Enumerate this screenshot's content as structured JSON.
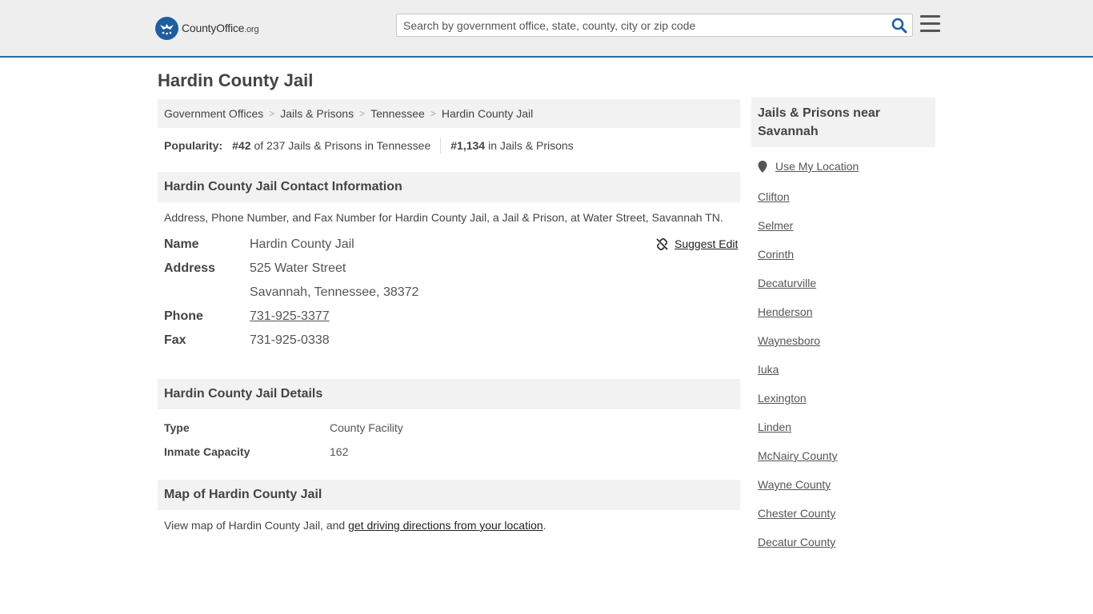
{
  "header": {
    "logo_main": "CountyOffice",
    "logo_tld": ".org",
    "search_placeholder": "Search by government office, state, county, city or zip code"
  },
  "page": {
    "title": "Hardin County Jail"
  },
  "breadcrumb": [
    "Government Offices",
    "Jails & Prisons",
    "Tennessee",
    "Hardin County Jail"
  ],
  "popularity": {
    "label": "Popularity:",
    "state_rank": "#42",
    "state_text": "of 237 Jails & Prisons in Tennessee",
    "national_rank": "#1,134",
    "national_text": "in Jails & Prisons"
  },
  "contact": {
    "heading": "Hardin County Jail Contact Information",
    "description": "Address, Phone Number, and Fax Number for Hardin County Jail, a Jail & Prison, at Water Street, Savannah TN.",
    "suggest_edit": "Suggest Edit",
    "name_label": "Name",
    "name": "Hardin County Jail",
    "address_label": "Address",
    "address_line1": "525 Water Street",
    "address_line2": "Savannah, Tennessee, 38372",
    "phone_label": "Phone",
    "phone": "731-925-3377",
    "fax_label": "Fax",
    "fax": "731-925-0338"
  },
  "details": {
    "heading": "Hardin County Jail Details",
    "type_label": "Type",
    "type": "County Facility",
    "capacity_label": "Inmate Capacity",
    "capacity": "162"
  },
  "map": {
    "heading": "Map of Hardin County Jail",
    "desc_prefix": "View map of Hardin County Jail, and ",
    "desc_link": "get driving directions from your location",
    "desc_suffix": "."
  },
  "sidebar": {
    "heading": "Jails & Prisons near Savannah",
    "use_location": "Use My Location",
    "items": [
      "Clifton",
      "Selmer",
      "Corinth",
      "Decaturville",
      "Henderson",
      "Waynesboro",
      "Iuka",
      "Lexington",
      "Linden",
      "McNairy County",
      "Wayne County",
      "Chester County",
      "Decatur County"
    ]
  },
  "colors": {
    "header_bg": "#eeeeee",
    "accent": "#2d6aa8",
    "logo_blue": "#1f5e9e",
    "panel_bg": "#f2f2f2"
  }
}
